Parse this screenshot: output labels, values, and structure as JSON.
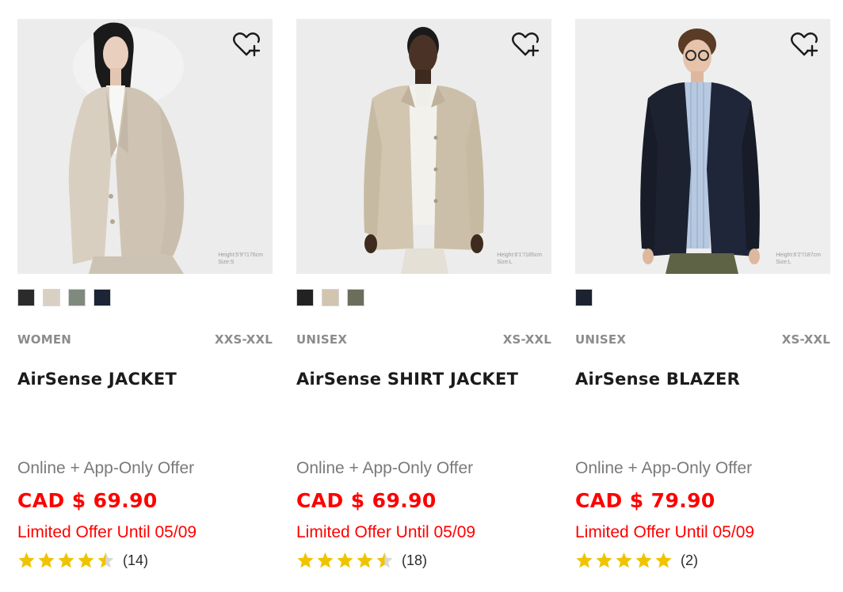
{
  "products": [
    {
      "gender": "WOMEN",
      "sizes": "XXS-XXL",
      "name": "AirSense JACKET",
      "offer": "Online + App-Only Offer",
      "price": "CAD $ 69.90",
      "limited": "Limited Offer Until 05/09",
      "rating": 4.5,
      "review_count": "(14)",
      "caption_height": "Height:5'9\"/176cm",
      "caption_size": "Size:S",
      "swatches": [
        "#2b2b2b",
        "#d9d0c4",
        "#7e8a7e",
        "#1c2436"
      ],
      "wishlist_icon": "heart-plus-icon"
    },
    {
      "gender": "UNISEX",
      "sizes": "XS-XXL",
      "name": "AirSense SHIRT JACKET",
      "offer": "Online + App-Only Offer",
      "price": "CAD $ 69.90",
      "limited": "Limited Offer Until 05/09",
      "rating": 4.5,
      "review_count": "(18)",
      "caption_height": "Height:6'1\"/185cm",
      "caption_size": "Size:L",
      "swatches": [
        "#222222",
        "#d3c4ae",
        "#6b6e5b"
      ],
      "wishlist_icon": "heart-plus-icon"
    },
    {
      "gender": "UNISEX",
      "sizes": "XS-XXL",
      "name": "AirSense BLAZER",
      "offer": "Online + App-Only Offer",
      "price": "CAD $ 79.90",
      "limited": "Limited Offer Until 05/09",
      "rating": 5,
      "review_count": "(2)",
      "caption_height": "Height:6'2\"/187cm",
      "caption_size": "Size:L",
      "swatches": [
        "#1d2230"
      ],
      "wishlist_icon": "heart-plus-icon"
    }
  ],
  "colors": {
    "price_red": "#ff0000",
    "star_gold": "#f0c300",
    "star_empty": "#d8d8d8"
  }
}
